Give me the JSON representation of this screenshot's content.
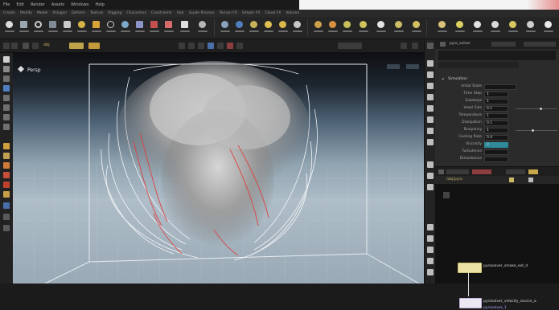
{
  "menu": {
    "items": [
      "File",
      "Edit",
      "Render",
      "Assets",
      "Windows",
      "Help"
    ]
  },
  "shelf": {
    "tabs": [
      "Create",
      "Modify",
      "Model",
      "Polygon",
      "Deform",
      "Texture",
      "Rigging",
      "Characters",
      "Constraints",
      "Hair",
      "Guide Process",
      "Terrain FX",
      "Simple FX",
      "Cloud FX",
      "Volume"
    ]
  },
  "toolbar": {
    "path_label": "obj"
  },
  "viewport": {
    "camera_label": "Persp",
    "credit_text": "..."
  },
  "parameters": {
    "header": "pyro_solver",
    "rows": [
      {
        "label": "Simulation",
        "value": ""
      },
      {
        "label": "Initial State",
        "value": ""
      },
      {
        "label": "Time Step",
        "value": "1"
      },
      {
        "label": "Substeps",
        "value": "1"
      },
      {
        "label": "Voxel Size",
        "value": "0.1"
      },
      {
        "label": "Temperature",
        "value": "1"
      },
      {
        "label": "Dissipation",
        "value": "0.1"
      },
      {
        "label": "Buoyancy",
        "value": "1"
      },
      {
        "label": "Cooling Rate",
        "value": "0.4"
      },
      {
        "label": "Viscosity",
        "value": "0"
      },
      {
        "label": "Turbulence",
        "value": ""
      },
      {
        "label": "Disturbance",
        "value": ""
      }
    ]
  },
  "network": {
    "path": "/obj/pyro",
    "node1_label": "pyrosolver_smoke_ext_d",
    "node2_label": "pyrosolver_velocity_source_a",
    "node2_sub": "pyrosolver_1"
  }
}
